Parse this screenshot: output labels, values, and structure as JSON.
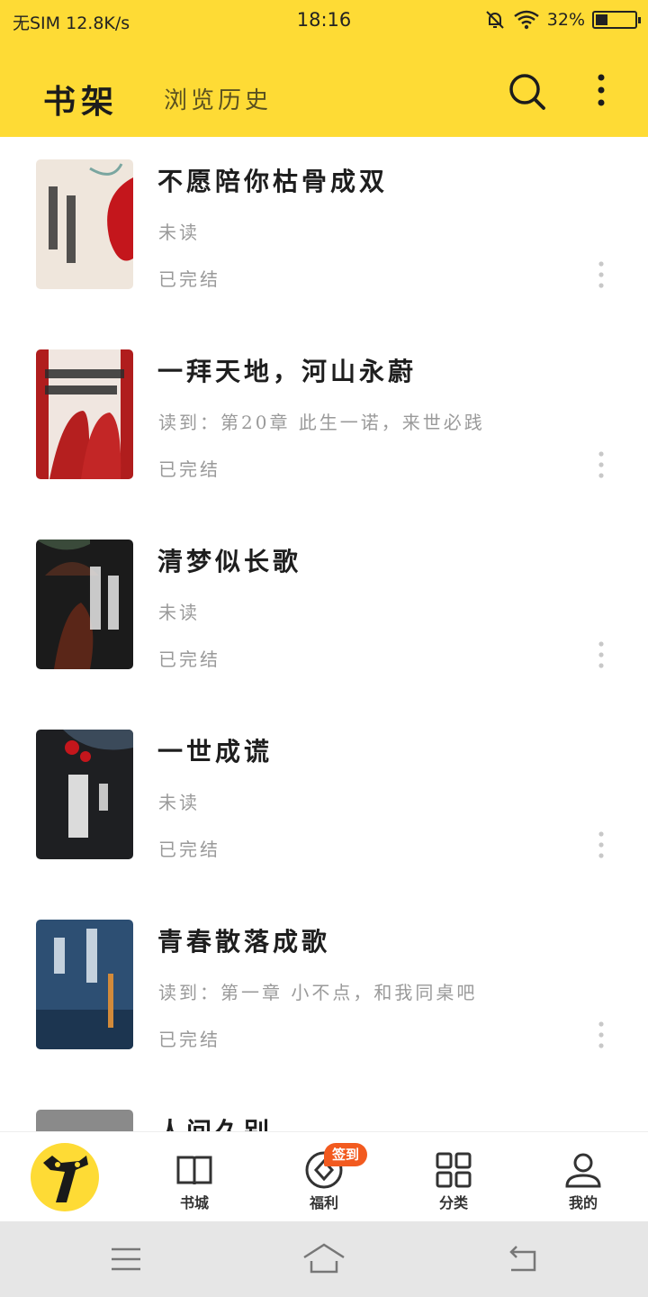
{
  "status_bar": {
    "carrier": "无SIM",
    "speed": "12.8K/s",
    "time": "18:16",
    "battery": "32%",
    "battery_level": 0.32
  },
  "header": {
    "tab_shelf": "书架",
    "tab_history": "浏览历史",
    "search_icon": "search-icon",
    "more_icon": "more-vertical-icon",
    "background_color": "#fedb35"
  },
  "books": [
    {
      "title": "不愿陪你枯骨成双",
      "progress": "未读",
      "status": "已完结"
    },
    {
      "title": "一拜天地，河山永蔚",
      "progress": "读到：第20章 此生一诺，来世必践",
      "status": "已完结"
    },
    {
      "title": "清梦似长歌",
      "progress": "未读",
      "status": "已完结"
    },
    {
      "title": "一世成谎",
      "progress": "未读",
      "status": "已完结"
    },
    {
      "title": "青春散落成歌",
      "progress": "读到：第一章 小不点，和我同桌吧",
      "status": "已完结"
    },
    {
      "title": "人间久别",
      "progress": "",
      "status": ""
    }
  ],
  "bottom_nav": {
    "bookstore": "书城",
    "welfare": "福利",
    "welfare_badge": "签到",
    "category": "分类",
    "mine": "我的",
    "badge_color": "#f25a1f"
  }
}
